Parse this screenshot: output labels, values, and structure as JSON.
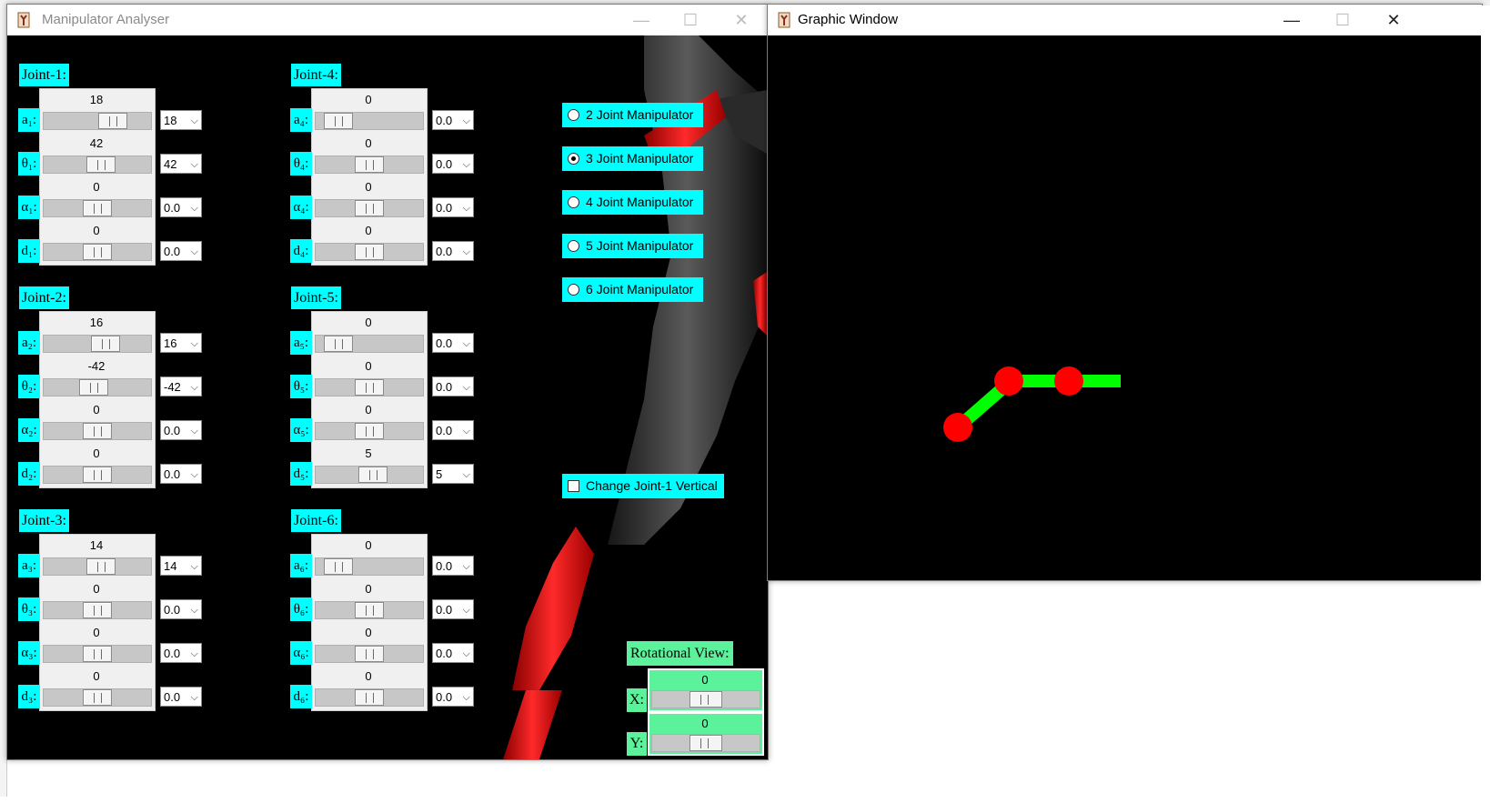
{
  "analyser": {
    "title": "Manipulator Analyser",
    "controls": {
      "minimize": "—",
      "maximize": "☐",
      "close": "✕"
    },
    "joints": [
      {
        "label": "Joint-1:",
        "params": [
          {
            "name": "a₁:",
            "value": "18",
            "pos": 0.7,
            "combo": "18"
          },
          {
            "name": "θ₁:",
            "value": "42",
            "pos": 0.55,
            "combo": "42"
          },
          {
            "name": "α₁:",
            "value": "0",
            "pos": 0.5,
            "combo": "0.0"
          },
          {
            "name": "d₁:",
            "value": "0",
            "pos": 0.5,
            "combo": "0.0"
          }
        ]
      },
      {
        "label": "Joint-2:",
        "params": [
          {
            "name": "a₂:",
            "value": "16",
            "pos": 0.6,
            "combo": "16"
          },
          {
            "name": "θ₂:",
            "value": "-42",
            "pos": 0.45,
            "combo": "-42"
          },
          {
            "name": "α₂:",
            "value": "0",
            "pos": 0.5,
            "combo": "0.0"
          },
          {
            "name": "d₂:",
            "value": "0",
            "pos": 0.5,
            "combo": "0.0"
          }
        ]
      },
      {
        "label": "Joint-3:",
        "params": [
          {
            "name": "a₃:",
            "value": "14",
            "pos": 0.55,
            "combo": "14"
          },
          {
            "name": "θ₃:",
            "value": "0",
            "pos": 0.5,
            "combo": "0.0"
          },
          {
            "name": "α₃:",
            "value": "0",
            "pos": 0.5,
            "combo": "0.0"
          },
          {
            "name": "d₃:",
            "value": "0",
            "pos": 0.5,
            "combo": "0.0"
          }
        ]
      },
      {
        "label": "Joint-4:",
        "params": [
          {
            "name": "a₄:",
            "value": "0",
            "pos": 0.1,
            "combo": "0.0"
          },
          {
            "name": "θ₄:",
            "value": "0",
            "pos": 0.5,
            "combo": "0.0"
          },
          {
            "name": "α₄:",
            "value": "0",
            "pos": 0.5,
            "combo": "0.0"
          },
          {
            "name": "d₄:",
            "value": "0",
            "pos": 0.5,
            "combo": "0.0"
          }
        ]
      },
      {
        "label": "Joint-5:",
        "params": [
          {
            "name": "a₅:",
            "value": "0",
            "pos": 0.1,
            "combo": "0.0"
          },
          {
            "name": "θ₅:",
            "value": "0",
            "pos": 0.5,
            "combo": "0.0"
          },
          {
            "name": "α₅:",
            "value": "0",
            "pos": 0.5,
            "combo": "0.0"
          },
          {
            "name": "d₅:",
            "value": "5",
            "pos": 0.55,
            "combo": "5"
          }
        ]
      },
      {
        "label": "Joint-6:",
        "params": [
          {
            "name": "a₆:",
            "value": "0",
            "pos": 0.1,
            "combo": "0.0"
          },
          {
            "name": "θ₆:",
            "value": "0",
            "pos": 0.5,
            "combo": "0.0"
          },
          {
            "name": "α₆:",
            "value": "0",
            "pos": 0.5,
            "combo": "0.0"
          },
          {
            "name": "d₆:",
            "value": "0",
            "pos": 0.5,
            "combo": "0.0"
          }
        ]
      }
    ],
    "radios": [
      {
        "label": "2 Joint Manipulator",
        "selected": false
      },
      {
        "label": "3 Joint Manipulator",
        "selected": true
      },
      {
        "label": "4 Joint Manipulator",
        "selected": false
      },
      {
        "label": "5 Joint Manipulator",
        "selected": false
      },
      {
        "label": "6 Joint Manipulator",
        "selected": false
      }
    ],
    "checkbox": {
      "label": "Change Joint-1 Vertical",
      "checked": false
    },
    "rotational": {
      "title": "Rotational View:",
      "x": {
        "axis": "X:",
        "value": "0",
        "pos": 0.5
      },
      "y": {
        "axis": "Y:",
        "value": "0",
        "pos": 0.5
      }
    }
  },
  "graphic": {
    "title": "Graphic Window",
    "controls": {
      "minimize": "—",
      "maximize": "☐",
      "close": "✕"
    }
  },
  "colors": {
    "accent": "#00ffff",
    "rotational": "#5cf29b",
    "link": "#00ff00",
    "joint": "#ff0000"
  }
}
